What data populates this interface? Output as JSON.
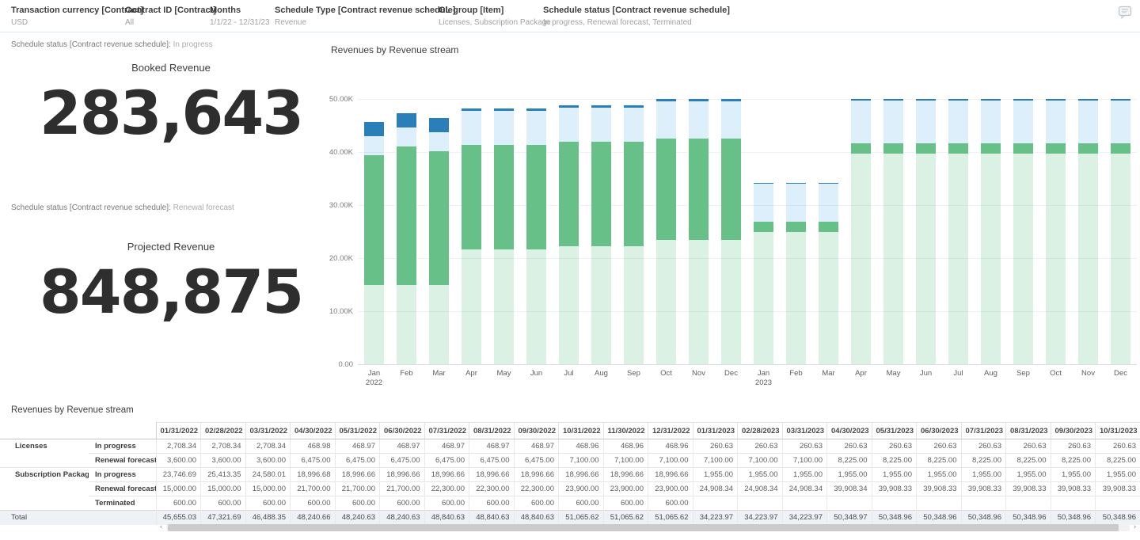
{
  "filters": [
    {
      "label": "Transaction currency [Contract]",
      "value": "USD"
    },
    {
      "label": "Contract ID [Contract]",
      "value": "All"
    },
    {
      "label": "Months",
      "value": "1/1/22 - 12/31/23"
    },
    {
      "label": "Schedule Type [Contract revenue schedule]",
      "value": "Revenue"
    },
    {
      "label": "GL group [Item]",
      "value": "Licenses, Subscription Package"
    },
    {
      "label": "Schedule status [Contract revenue schedule]",
      "value": "In progress, Renewal forecast, Terminated"
    }
  ],
  "icons": {
    "comment": "comment-bubble"
  },
  "kpis": [
    {
      "status_label": "Schedule status [Contract revenue schedule]:",
      "status_value": "In progress",
      "title": "Booked Revenue",
      "value": "283,643"
    },
    {
      "status_label": "Schedule status [Contract revenue schedule]:",
      "status_value": "Renewal forecast",
      "title": "Projected Revenue",
      "value": "848,875"
    }
  ],
  "chart_data": {
    "type": "bar",
    "stacked": true,
    "title": "Revenues by Revenue stream",
    "xlabel": "",
    "ylabel": "",
    "ylim": [
      0,
      50000
    ],
    "yticks": [
      "0.00",
      "10.00K",
      "20.00K",
      "30.00K",
      "40.00K",
      "50.00K"
    ],
    "grid": true,
    "legend_position": "none",
    "x": [
      "Jan",
      "Feb",
      "Mar",
      "Apr",
      "May",
      "Jun",
      "Jul",
      "Aug",
      "Sep",
      "Oct",
      "Nov",
      "Dec",
      "Jan",
      "Feb",
      "Mar",
      "Apr",
      "May",
      "Jun",
      "Jul",
      "Aug",
      "Sep",
      "Oct",
      "Nov",
      "Dec"
    ],
    "year_marks": [
      {
        "index": 0,
        "label": "2022"
      },
      {
        "index": 12,
        "label": "2023"
      }
    ],
    "series": [
      {
        "name": "Subscription Package - Renewal forecast",
        "color": "rgba(118,203,150,0.27)",
        "values": [
          15000,
          15000,
          15000,
          21700,
          21700,
          21700,
          22300,
          22300,
          22300,
          23900,
          23900,
          23900,
          24908.34,
          24908.34,
          24908.34,
          39908.34,
          39908.33,
          39908.33,
          39908.33,
          39908.33,
          39908.33,
          39908.33,
          39908.33,
          39908.33
        ]
      },
      {
        "name": "Subscription Package - In progress",
        "color": "#66c088",
        "values": [
          23746.69,
          25413.35,
          24580.01,
          18996.68,
          18996.66,
          18996.66,
          18996.66,
          18996.66,
          18996.66,
          18996.66,
          18996.66,
          18996.66,
          1955,
          1955,
          1955,
          1955,
          1955,
          1955,
          1955,
          1955,
          1955,
          1955,
          1955,
          1955
        ]
      },
      {
        "name": "Subscription Package - Terminated",
        "color": "#66c088",
        "values": [
          600,
          600,
          600,
          600,
          600,
          600,
          600,
          600,
          600,
          600,
          600,
          600,
          0,
          0,
          0,
          0,
          0,
          0,
          0,
          0,
          0,
          0,
          0,
          0
        ]
      },
      {
        "name": "Licenses - Renewal forecast",
        "color": "rgba(96,180,234,0.21)",
        "values": [
          3600,
          3600,
          3600,
          6475,
          6475,
          6475,
          6475,
          6475,
          6475,
          7100,
          7100,
          7100,
          7100,
          7100,
          7100,
          8225,
          8225,
          8225,
          8225,
          8225,
          8225,
          8225,
          8225,
          8225
        ]
      },
      {
        "name": "Licenses - In progress",
        "color": "#2b7fb8",
        "values": [
          2708.34,
          2708.34,
          2708.34,
          468.98,
          468.97,
          468.97,
          468.97,
          468.97,
          468.97,
          468.96,
          468.96,
          468.96,
          260.63,
          260.63,
          260.63,
          260.63,
          260.63,
          260.63,
          260.63,
          260.63,
          260.63,
          260.63,
          260.63,
          260.63
        ]
      }
    ]
  },
  "table": {
    "title": "Revenues by Revenue stream",
    "columns": [
      "01/31/2022",
      "02/28/2022",
      "03/31/2022",
      "04/30/2022",
      "05/31/2022",
      "06/30/2022",
      "07/31/2022",
      "08/31/2022",
      "09/30/2022",
      "10/31/2022",
      "11/30/2022",
      "12/31/2022",
      "01/31/2023",
      "02/28/2023",
      "03/31/2023",
      "04/30/2023",
      "05/31/2023",
      "06/30/2023",
      "07/31/2023",
      "08/31/2023",
      "09/30/2023",
      "10/31/2023"
    ],
    "rows": [
      {
        "group": "Licenses",
        "span": 2,
        "status": "In progress",
        "values": [
          "2,708.34",
          "2,708.34",
          "2,708.34",
          "468.98",
          "468.97",
          "468.97",
          "468.97",
          "468.97",
          "468.97",
          "468.96",
          "468.96",
          "468.96",
          "260.63",
          "260.63",
          "260.63",
          "260.63",
          "260.63",
          "260.63",
          "260.63",
          "260.63",
          "260.63",
          "260.63"
        ]
      },
      {
        "group": "",
        "status": "Renewal forecast",
        "values": [
          "3,600.00",
          "3,600.00",
          "3,600.00",
          "6,475.00",
          "6,475.00",
          "6,475.00",
          "6,475.00",
          "6,475.00",
          "6,475.00",
          "7,100.00",
          "7,100.00",
          "7,100.00",
          "7,100.00",
          "7,100.00",
          "7,100.00",
          "8,225.00",
          "8,225.00",
          "8,225.00",
          "8,225.00",
          "8,225.00",
          "8,225.00",
          "8,225.00"
        ]
      },
      {
        "group": "Subscription Package",
        "span": 3,
        "status": "In progress",
        "values": [
          "23,746.69",
          "25,413.35",
          "24,580.01",
          "18,996.68",
          "18,996.66",
          "18,996.66",
          "18,996.66",
          "18,996.66",
          "18,996.66",
          "18,996.66",
          "18,996.66",
          "18,996.66",
          "1,955.00",
          "1,955.00",
          "1,955.00",
          "1,955.00",
          "1,955.00",
          "1,955.00",
          "1,955.00",
          "1,955.00",
          "1,955.00",
          "1,955.00"
        ]
      },
      {
        "group": "",
        "status": "Renewal forecast",
        "values": [
          "15,000.00",
          "15,000.00",
          "15,000.00",
          "21,700.00",
          "21,700.00",
          "21,700.00",
          "22,300.00",
          "22,300.00",
          "22,300.00",
          "23,900.00",
          "23,900.00",
          "23,900.00",
          "24,908.34",
          "24,908.34",
          "24,908.34",
          "39,908.34",
          "39,908.33",
          "39,908.33",
          "39,908.33",
          "39,908.33",
          "39,908.33",
          "39,908.33"
        ]
      },
      {
        "group": "",
        "status": "Terminated",
        "values": [
          "600.00",
          "600.00",
          "600.00",
          "600.00",
          "600.00",
          "600.00",
          "600.00",
          "600.00",
          "600.00",
          "600.00",
          "600.00",
          "600.00",
          "",
          "",
          "",
          "",
          "",
          "",
          "",
          "",
          "",
          ""
        ]
      }
    ],
    "total": {
      "label": "Total",
      "values": [
        "45,655.03",
        "47,321.69",
        "46,488.35",
        "48,240.66",
        "48,240.63",
        "48,240.63",
        "48,840.63",
        "48,840.63",
        "48,840.63",
        "51,065.62",
        "51,065.62",
        "51,065.62",
        "34,223.97",
        "34,223.97",
        "34,223.97",
        "50,348.97",
        "50,348.96",
        "50,348.96",
        "50,348.96",
        "50,348.96",
        "50,348.96",
        "50,348.96"
      ]
    }
  },
  "scrollbar": {
    "left_arrow": "‹",
    "right_arrow": "›"
  }
}
